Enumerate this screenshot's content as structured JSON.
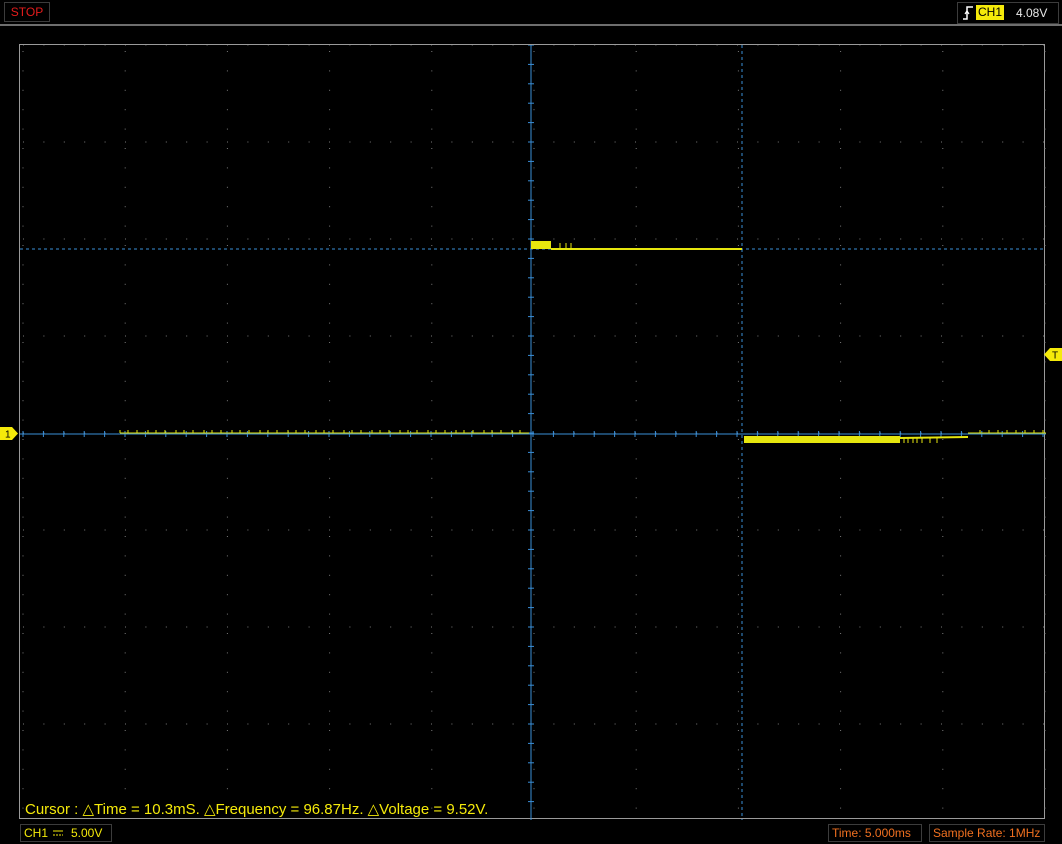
{
  "status": {
    "run_state": "STOP"
  },
  "trigger": {
    "channel": "CH1",
    "level": "4.08V",
    "edge_icon": "rising-edge-icon",
    "marker_label": "T"
  },
  "channel": {
    "marker_label": "1",
    "label": "CH1",
    "coupling_icon": "dc-coupling-icon",
    "volts_per_div": "5.00V",
    "trace_color": "#e6e60e"
  },
  "cursor": {
    "readout": "Cursor : △Time = 10.3mS. △Frequency = 96.87Hz. △Voltage = 9.52V."
  },
  "timebase": {
    "label": "Time: 5.000ms"
  },
  "sample_rate": {
    "label": "Sample Rate: 1MHz"
  },
  "colors": {
    "grid": "#7a7a7a",
    "axis": "#3a8fd8",
    "cursor": "#3a8fd8",
    "trace": "#e6e60e",
    "stop": "#e31c1c",
    "orange_text": "#f07020"
  }
}
